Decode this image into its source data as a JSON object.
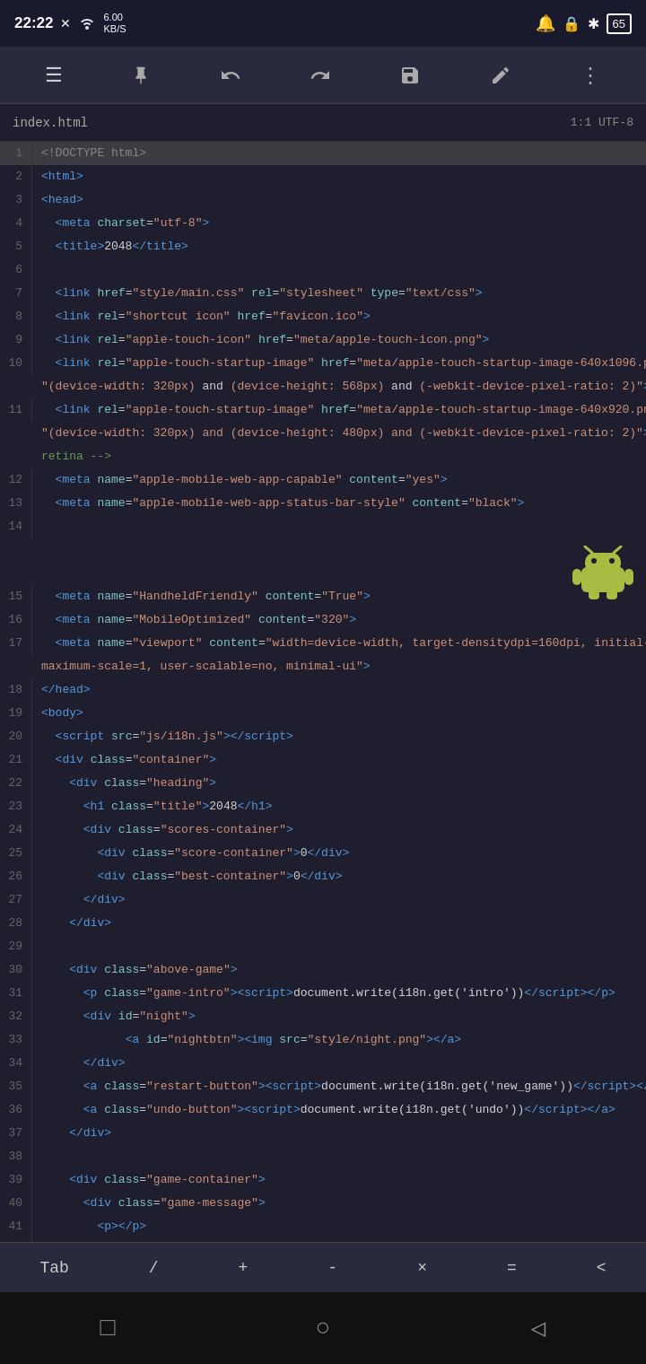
{
  "status_bar": {
    "time": "22:22",
    "network": "6.00\nKB/S",
    "battery": "65"
  },
  "toolbar": {
    "menu_label": "☰",
    "pin_label": "📌",
    "undo_label": "↩",
    "redo_label": "↪",
    "save_label": "💾",
    "edit_label": "✏",
    "more_label": "⋮"
  },
  "file_tab": {
    "name": "index.html",
    "cursor_info": "1:1  UTF-8"
  },
  "bottom_bar": {
    "tab": "Tab",
    "slash": "/",
    "plus": "+",
    "minus": "-",
    "mult": "×",
    "equals": "=",
    "lt": "<"
  },
  "nav_bar": {
    "square": "□",
    "circle": "○",
    "back": "◁"
  }
}
